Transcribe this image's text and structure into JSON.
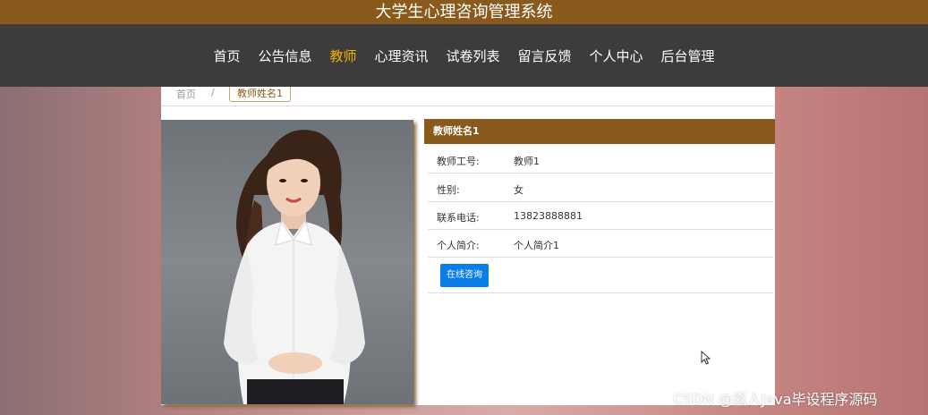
{
  "header": {
    "title": "大学生心理咨询管理系统"
  },
  "nav": {
    "items": [
      {
        "label": "首页"
      },
      {
        "label": "公告信息"
      },
      {
        "label": "教师"
      },
      {
        "label": "心理资讯"
      },
      {
        "label": "试卷列表"
      },
      {
        "label": "留言反馈"
      },
      {
        "label": "个人中心"
      },
      {
        "label": "后台管理"
      }
    ],
    "active_index": 2,
    "active_color": "#f0b400"
  },
  "breadcrumb": {
    "home": "首页",
    "separator": "/",
    "current": "教师姓名1"
  },
  "teacher": {
    "name": "教师姓名1",
    "fields": [
      {
        "label": "教师工号:",
        "value": "教师1"
      },
      {
        "label": "性别:",
        "value": "女"
      },
      {
        "label": "联系电话:",
        "value": "13823888881"
      },
      {
        "label": "个人简介:",
        "value": "个人简介1"
      }
    ],
    "consult_button": "在线咨询"
  },
  "colors": {
    "brand_brown": "#8a5a1c",
    "nav_bg": "#3e3c3a",
    "button_blue": "#0b7de8"
  },
  "watermark": "CSDN @嘉人Java毕设程序源码",
  "icons": {
    "cursor": "mouse-pointer-icon"
  }
}
